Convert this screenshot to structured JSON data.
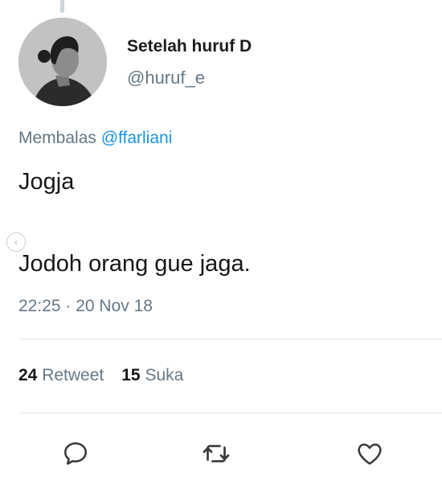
{
  "author": {
    "display_name": "Setelah huruf D",
    "handle": "@huruf_e"
  },
  "reply_context": {
    "prefix": "Membalas",
    "mention": "@ffarliani"
  },
  "tweet": {
    "lines": [
      "Jogja",
      "Jodoh orang gue jaga."
    ],
    "timestamp": "22:25 · 20 Nov 18"
  },
  "stats": {
    "retweet_count": "24",
    "retweet_label": "Retweet",
    "like_count": "15",
    "like_label": "Suka"
  },
  "carousel": {
    "arrow_glyph": "‹"
  },
  "actions": [
    {
      "icon": "reply-icon"
    },
    {
      "icon": "retweet-icon"
    },
    {
      "icon": "heart-icon"
    }
  ],
  "colors": {
    "mention_blue": "#1b95e0",
    "muted_gray": "#657786",
    "text_dark": "#14171a",
    "divider": "#e1e8ed"
  }
}
